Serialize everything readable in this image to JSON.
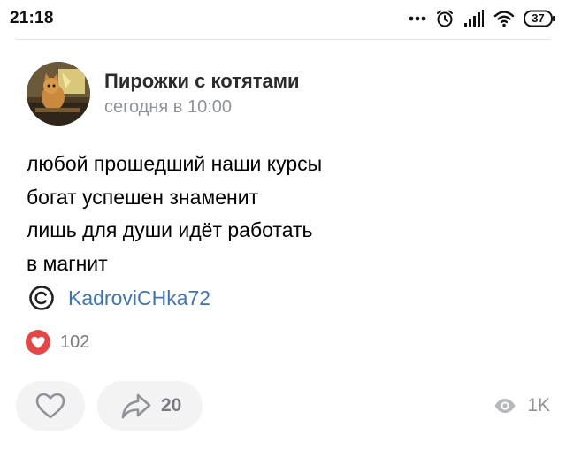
{
  "status_bar": {
    "time": "21:18",
    "icons": [
      "more-dots-icon",
      "alarm-icon",
      "signal-icon",
      "wifi-icon",
      "battery-icon"
    ],
    "battery_level": "37"
  },
  "post": {
    "group_name": "Пирожки с котятами",
    "time": "сегодня в 10:00",
    "lines": [
      "любой прошедший наши курсы",
      "богат успешен знаменит",
      "лишь для души идёт работать",
      "в магнит"
    ],
    "signer": "KadroviCHka72",
    "reaction_count": "102"
  },
  "actions": {
    "share_count": "20",
    "views_count": "1K"
  },
  "colors": {
    "accent_link": "#3f73b8",
    "secondary_text": "#8f9399",
    "reaction_red": "#e64646",
    "button_bg": "#f3f3f4"
  }
}
